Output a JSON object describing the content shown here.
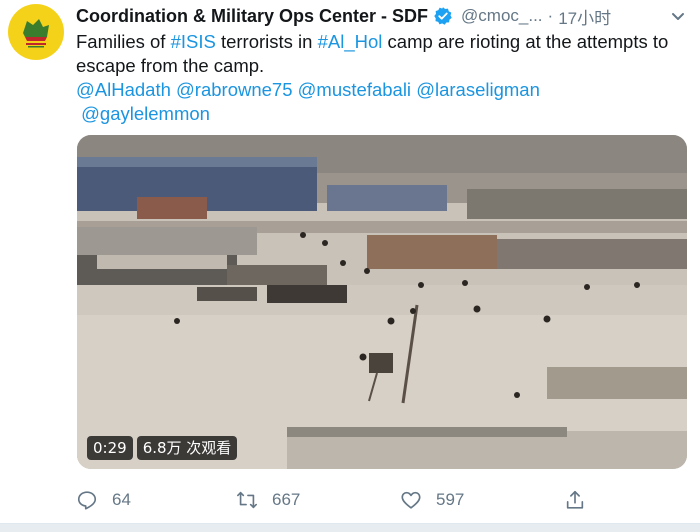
{
  "tweet": {
    "display_name": "Coordination & Military Ops Center - SDF",
    "handle": "@cmoc_...",
    "separator": "·",
    "time": "17小时",
    "text": {
      "t1": "Families of ",
      "tag1": "#ISIS",
      "t2": " terrorists in ",
      "tag2": "#Al_Hol",
      "t3": " camp are rioting at the attempts to escape from the camp.",
      "m1": "@AlHadath",
      "m2": "@rabrowne75",
      "m3": "@mustefabali",
      "m4": "@laraseligman",
      "m5": "@gaylelemmon"
    },
    "video": {
      "duration": "0:29",
      "views": "6.8万 次观看"
    },
    "actions": {
      "replies": "64",
      "retweets": "667",
      "likes": "597"
    }
  },
  "icons": {
    "avatar": "sdf-logo-icon",
    "verified": "verified-badge-icon",
    "caret": "chevron-down-icon",
    "reply": "reply-icon",
    "retweet": "retweet-icon",
    "like": "heart-icon",
    "share": "share-icon"
  },
  "colors": {
    "link": "#1b95e0",
    "secondary": "#657786",
    "avatar_bg": "#f5d21a",
    "verified": "#1da1f2"
  }
}
